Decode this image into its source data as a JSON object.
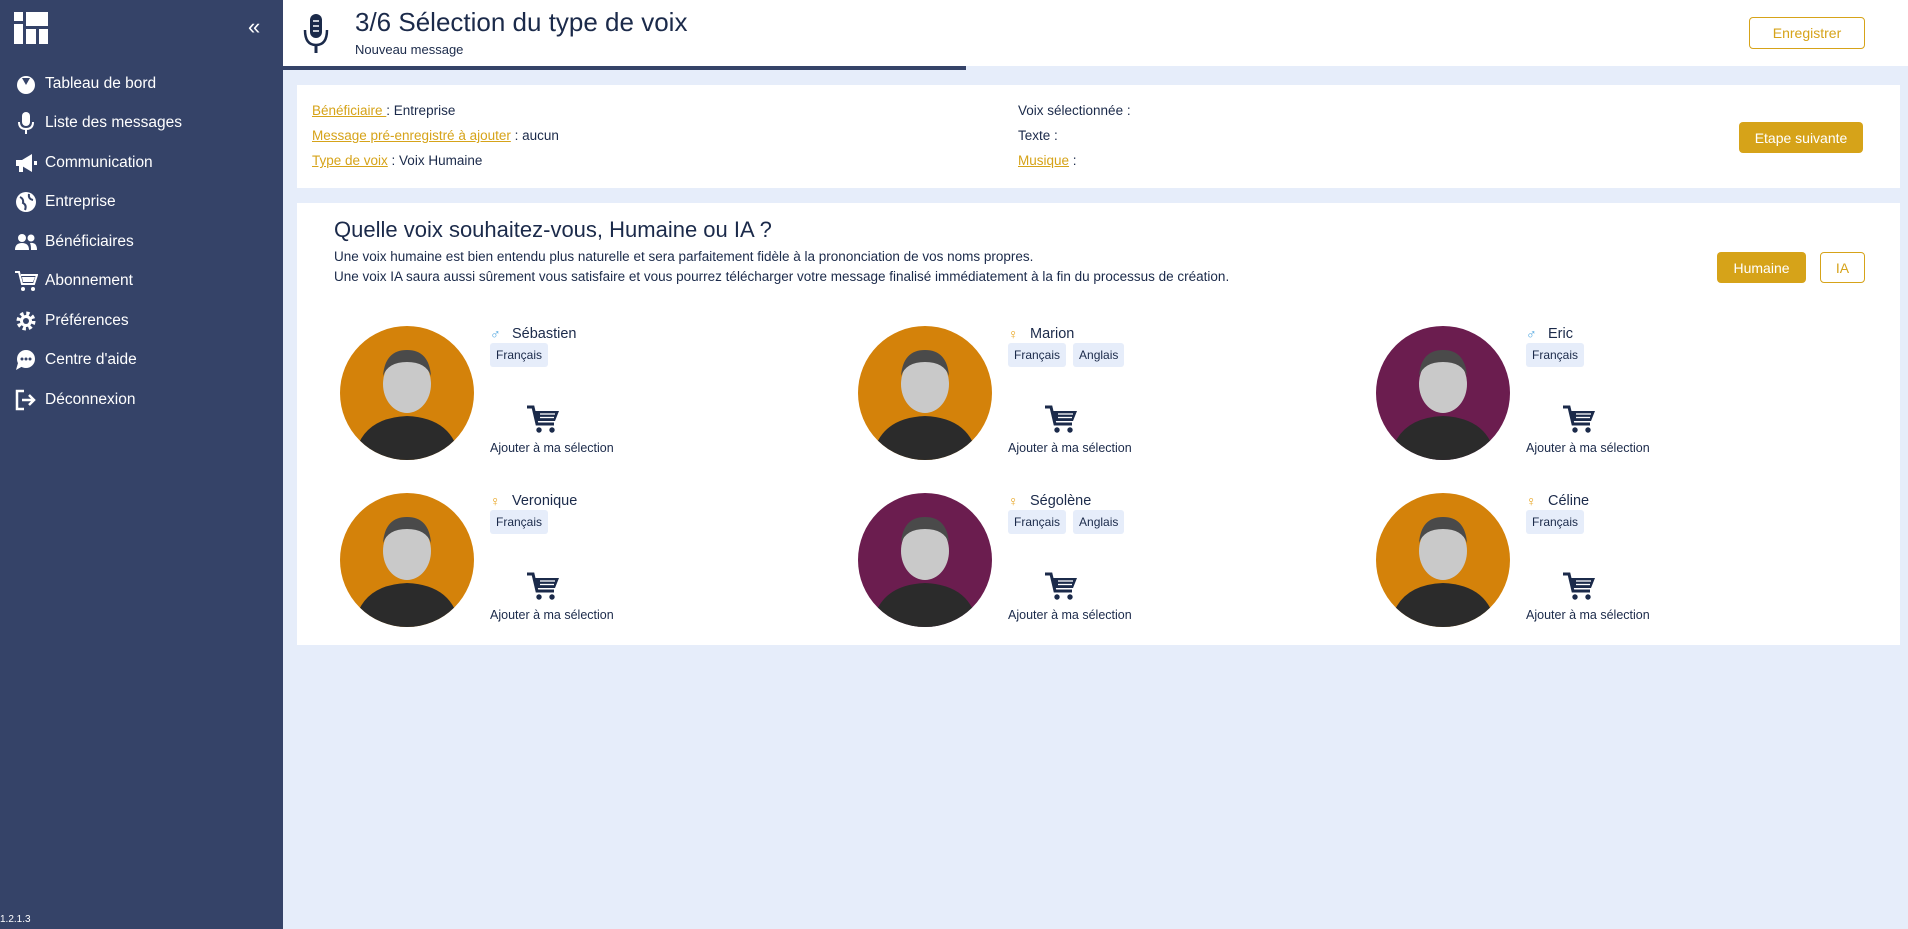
{
  "sidebar": {
    "version": "1.2.1.3",
    "items": [
      {
        "label": "Tableau de bord",
        "icon": "dashboard-icon"
      },
      {
        "label": "Liste des messages",
        "icon": "microphone-icon"
      },
      {
        "label": "Communication",
        "icon": "megaphone-icon"
      },
      {
        "label": "Entreprise",
        "icon": "globe-icon"
      },
      {
        "label": "Bénéficiaires",
        "icon": "users-icon"
      },
      {
        "label": "Abonnement",
        "icon": "cart-icon"
      },
      {
        "label": "Préférences",
        "icon": "gear-icon"
      },
      {
        "label": "Centre d'aide",
        "icon": "chat-icon"
      },
      {
        "label": "Déconnexion",
        "icon": "logout-icon"
      }
    ]
  },
  "header": {
    "title": "3/6  Sélection du type de voix",
    "subtitle": "Nouveau message",
    "save_label": "Enregistrer",
    "progress": 0.42
  },
  "summary": {
    "beneficiaire_label": "Bénéficiaire ",
    "beneficiaire_value": " : Entreprise",
    "message_label": "Message pré-enregistré à ajouter",
    "message_value": " : aucun",
    "type_label": "Type de voix",
    "type_value": " : Voix Humaine",
    "voix_label": "Voix sélectionnée :",
    "texte_label": "Texte :",
    "musique_label": "Musique",
    "musique_value": " :",
    "next_label": "Etape suivante"
  },
  "voices": {
    "title": "Quelle voix souhaitez-vous, Humaine ou IA ?",
    "desc1": "Une voix humaine est bien entendu plus naturelle et sera parfaitement fidèle à la prononciation de vos noms propres.",
    "desc2": "Une voix IA saura aussi sûrement vous satisfaire et vous pourrez télécharger votre message finalisé immédiatement à la fin du processus de création.",
    "human_label": "Humaine",
    "ia_label": "IA",
    "add_label": "Ajouter à ma sélection",
    "list": [
      {
        "name": "Sébastien",
        "gender": "male",
        "langs": [
          "Français"
        ],
        "bg": "#d4820a"
      },
      {
        "name": "Marion",
        "gender": "female",
        "langs": [
          "Français",
          "Anglais"
        ],
        "bg": "#d4820a"
      },
      {
        "name": "Eric",
        "gender": "male",
        "langs": [
          "Français"
        ],
        "bg": "#6b1d4f"
      },
      {
        "name": "Veronique",
        "gender": "female",
        "langs": [
          "Français"
        ],
        "bg": "#d4820a"
      },
      {
        "name": "Ségolène",
        "gender": "female",
        "langs": [
          "Français",
          "Anglais"
        ],
        "bg": "#6b1d4f"
      },
      {
        "name": "Céline",
        "gender": "female",
        "langs": [
          "Français"
        ],
        "bg": "#d4820a"
      }
    ]
  },
  "colors": {
    "sidebar": "#354368",
    "accent": "#d6a319",
    "background": "#e6edfa",
    "male": "#4aa3df",
    "female": "#e8a31b"
  }
}
